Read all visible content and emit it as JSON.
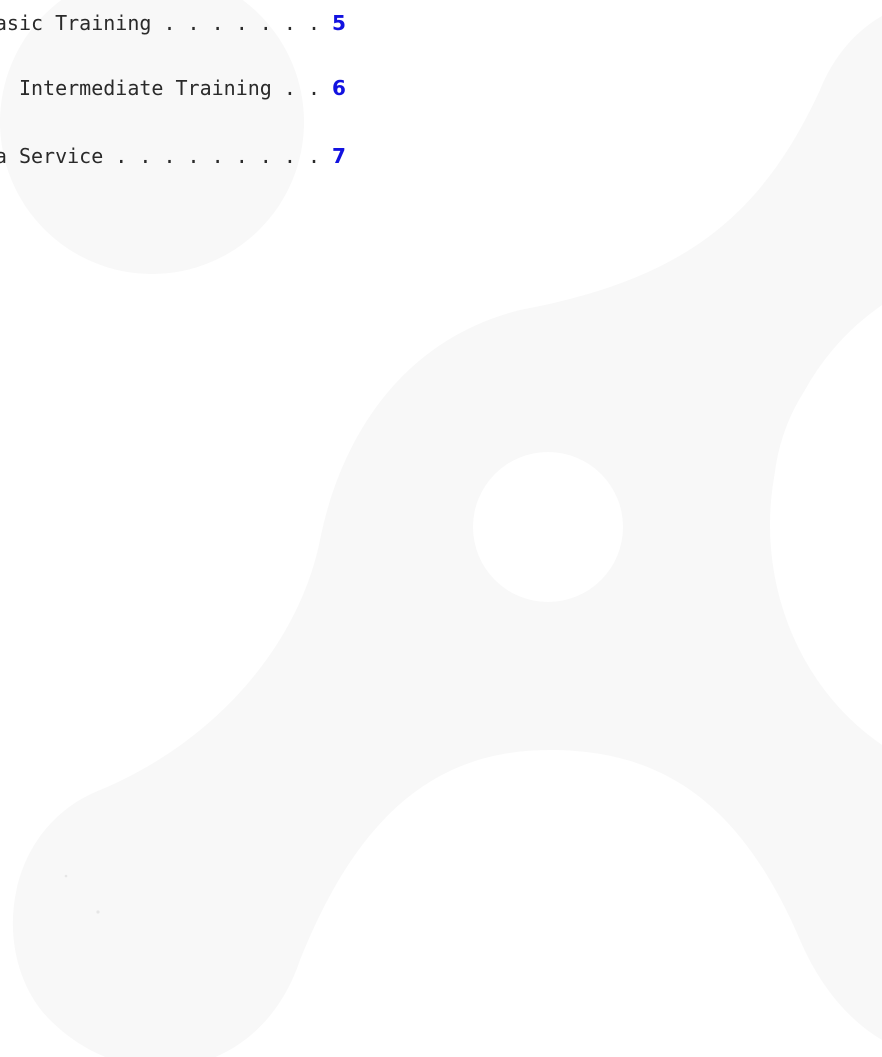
{
  "toc": {
    "entries": [
      {
        "label": "Basic Training . . . . . . .",
        "page": "5"
      },
      {
        "label": "Intermediate Training . .",
        "page": "6"
      },
      {
        "label": "as a Service . . . . . . . . .",
        "page": "7"
      }
    ]
  },
  "colors": {
    "page_number": "#1212e0",
    "text": "#2a2a2a",
    "watermark": "#f8f8f8"
  },
  "icons": {
    "watermark": "brand-logo-watermark-icon"
  }
}
